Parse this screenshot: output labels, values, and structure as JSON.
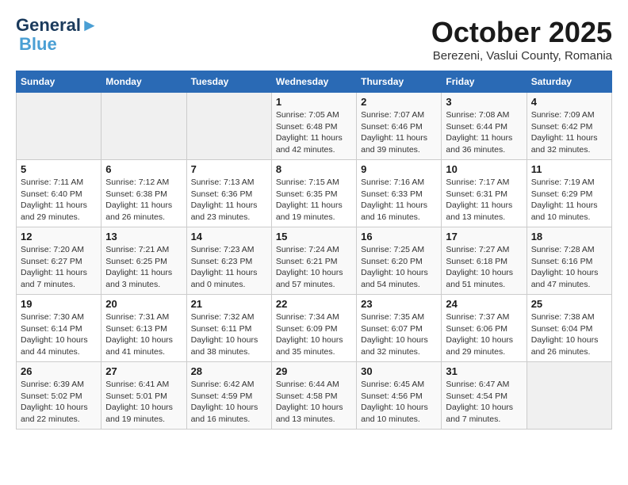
{
  "header": {
    "logo_line1": "General",
    "logo_line2": "Blue",
    "month": "October 2025",
    "location": "Berezeni, Vaslui County, Romania"
  },
  "weekdays": [
    "Sunday",
    "Monday",
    "Tuesday",
    "Wednesday",
    "Thursday",
    "Friday",
    "Saturday"
  ],
  "weeks": [
    [
      {
        "day": "",
        "info": ""
      },
      {
        "day": "",
        "info": ""
      },
      {
        "day": "",
        "info": ""
      },
      {
        "day": "1",
        "info": "Sunrise: 7:05 AM\nSunset: 6:48 PM\nDaylight: 11 hours and 42 minutes."
      },
      {
        "day": "2",
        "info": "Sunrise: 7:07 AM\nSunset: 6:46 PM\nDaylight: 11 hours and 39 minutes."
      },
      {
        "day": "3",
        "info": "Sunrise: 7:08 AM\nSunset: 6:44 PM\nDaylight: 11 hours and 36 minutes."
      },
      {
        "day": "4",
        "info": "Sunrise: 7:09 AM\nSunset: 6:42 PM\nDaylight: 11 hours and 32 minutes."
      }
    ],
    [
      {
        "day": "5",
        "info": "Sunrise: 7:11 AM\nSunset: 6:40 PM\nDaylight: 11 hours and 29 minutes."
      },
      {
        "day": "6",
        "info": "Sunrise: 7:12 AM\nSunset: 6:38 PM\nDaylight: 11 hours and 26 minutes."
      },
      {
        "day": "7",
        "info": "Sunrise: 7:13 AM\nSunset: 6:36 PM\nDaylight: 11 hours and 23 minutes."
      },
      {
        "day": "8",
        "info": "Sunrise: 7:15 AM\nSunset: 6:35 PM\nDaylight: 11 hours and 19 minutes."
      },
      {
        "day": "9",
        "info": "Sunrise: 7:16 AM\nSunset: 6:33 PM\nDaylight: 11 hours and 16 minutes."
      },
      {
        "day": "10",
        "info": "Sunrise: 7:17 AM\nSunset: 6:31 PM\nDaylight: 11 hours and 13 minutes."
      },
      {
        "day": "11",
        "info": "Sunrise: 7:19 AM\nSunset: 6:29 PM\nDaylight: 11 hours and 10 minutes."
      }
    ],
    [
      {
        "day": "12",
        "info": "Sunrise: 7:20 AM\nSunset: 6:27 PM\nDaylight: 11 hours and 7 minutes."
      },
      {
        "day": "13",
        "info": "Sunrise: 7:21 AM\nSunset: 6:25 PM\nDaylight: 11 hours and 3 minutes."
      },
      {
        "day": "14",
        "info": "Sunrise: 7:23 AM\nSunset: 6:23 PM\nDaylight: 11 hours and 0 minutes."
      },
      {
        "day": "15",
        "info": "Sunrise: 7:24 AM\nSunset: 6:21 PM\nDaylight: 10 hours and 57 minutes."
      },
      {
        "day": "16",
        "info": "Sunrise: 7:25 AM\nSunset: 6:20 PM\nDaylight: 10 hours and 54 minutes."
      },
      {
        "day": "17",
        "info": "Sunrise: 7:27 AM\nSunset: 6:18 PM\nDaylight: 10 hours and 51 minutes."
      },
      {
        "day": "18",
        "info": "Sunrise: 7:28 AM\nSunset: 6:16 PM\nDaylight: 10 hours and 47 minutes."
      }
    ],
    [
      {
        "day": "19",
        "info": "Sunrise: 7:30 AM\nSunset: 6:14 PM\nDaylight: 10 hours and 44 minutes."
      },
      {
        "day": "20",
        "info": "Sunrise: 7:31 AM\nSunset: 6:13 PM\nDaylight: 10 hours and 41 minutes."
      },
      {
        "day": "21",
        "info": "Sunrise: 7:32 AM\nSunset: 6:11 PM\nDaylight: 10 hours and 38 minutes."
      },
      {
        "day": "22",
        "info": "Sunrise: 7:34 AM\nSunset: 6:09 PM\nDaylight: 10 hours and 35 minutes."
      },
      {
        "day": "23",
        "info": "Sunrise: 7:35 AM\nSunset: 6:07 PM\nDaylight: 10 hours and 32 minutes."
      },
      {
        "day": "24",
        "info": "Sunrise: 7:37 AM\nSunset: 6:06 PM\nDaylight: 10 hours and 29 minutes."
      },
      {
        "day": "25",
        "info": "Sunrise: 7:38 AM\nSunset: 6:04 PM\nDaylight: 10 hours and 26 minutes."
      }
    ],
    [
      {
        "day": "26",
        "info": "Sunrise: 6:39 AM\nSunset: 5:02 PM\nDaylight: 10 hours and 22 minutes."
      },
      {
        "day": "27",
        "info": "Sunrise: 6:41 AM\nSunset: 5:01 PM\nDaylight: 10 hours and 19 minutes."
      },
      {
        "day": "28",
        "info": "Sunrise: 6:42 AM\nSunset: 4:59 PM\nDaylight: 10 hours and 16 minutes."
      },
      {
        "day": "29",
        "info": "Sunrise: 6:44 AM\nSunset: 4:58 PM\nDaylight: 10 hours and 13 minutes."
      },
      {
        "day": "30",
        "info": "Sunrise: 6:45 AM\nSunset: 4:56 PM\nDaylight: 10 hours and 10 minutes."
      },
      {
        "day": "31",
        "info": "Sunrise: 6:47 AM\nSunset: 4:54 PM\nDaylight: 10 hours and 7 minutes."
      },
      {
        "day": "",
        "info": ""
      }
    ]
  ]
}
